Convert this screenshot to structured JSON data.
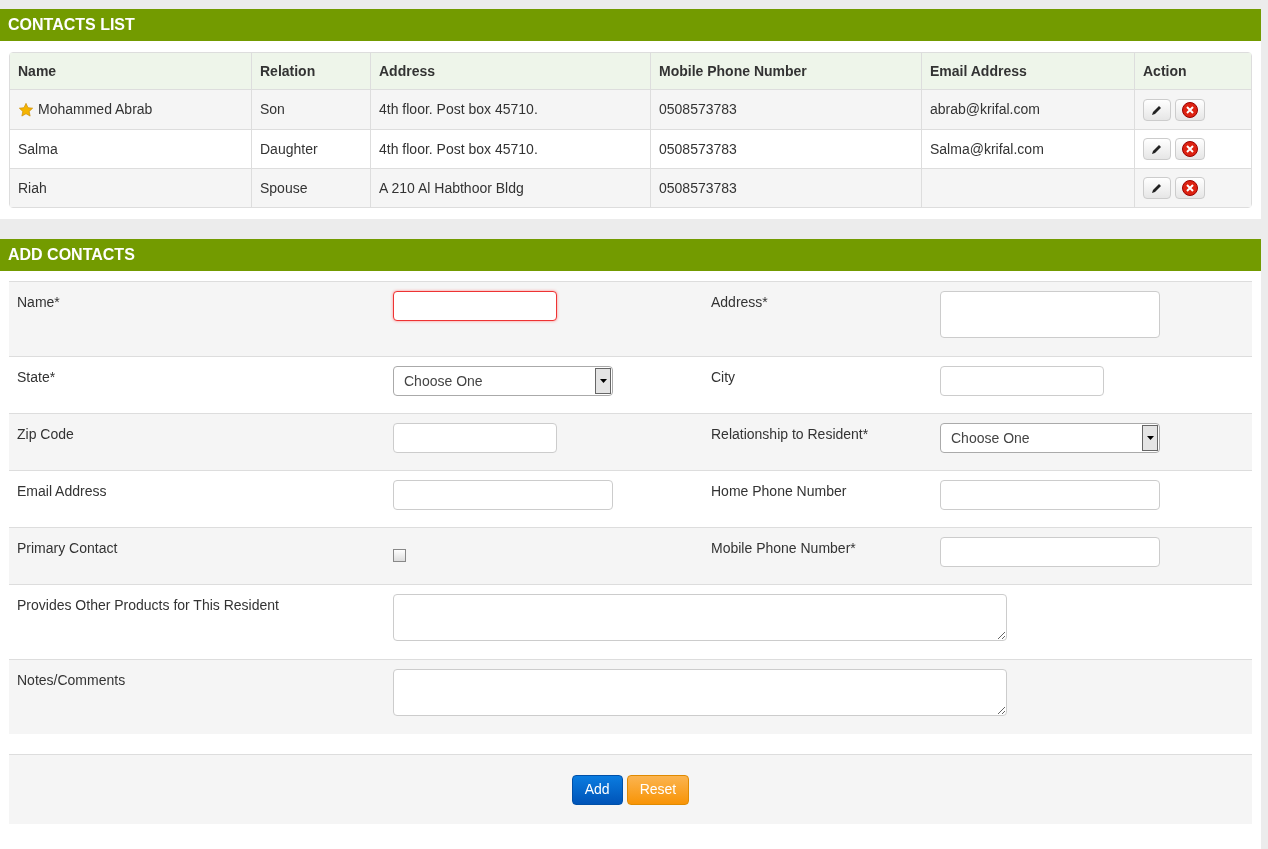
{
  "contacts_list": {
    "title": "CONTACTS LIST",
    "columns": [
      "Name",
      "Relation",
      "Address",
      "Mobile Phone Number",
      "Email Address",
      "Action"
    ],
    "rows": [
      {
        "primary": true,
        "cells": [
          "Mohammed Abrab",
          "Son",
          "4th floor. Post box 45710.",
          "0508573783",
          "abrab@krifal.com"
        ]
      },
      {
        "primary": false,
        "cells": [
          "Salma",
          "Daughter",
          "4th floor. Post box 45710.",
          "0508573783",
          "Salma@krifal.com"
        ]
      },
      {
        "primary": false,
        "cells": [
          "Riah",
          "Spouse",
          "A 210 Al Habthoor Bldg",
          "0508573783",
          ""
        ]
      }
    ]
  },
  "add_contacts": {
    "title": "ADD CONTACTS",
    "rows": [
      {
        "fields": [
          {
            "label": "Name*",
            "kind": "short",
            "invalid": true
          },
          {
            "label": "Address*",
            "kind": "area",
            "invalid": false
          }
        ]
      },
      {
        "fields": [
          {
            "label": "State*",
            "kind": "select",
            "value": "Choose One"
          },
          {
            "label": "City",
            "kind": "short",
            "invalid": false
          }
        ]
      },
      {
        "fields": [
          {
            "label": "Zip Code",
            "kind": "short",
            "invalid": false
          },
          {
            "label": "Relationship to Resident*",
            "kind": "select",
            "value": "Choose One"
          }
        ]
      },
      {
        "fields": [
          {
            "label": "Email Address",
            "kind": "text",
            "invalid": false
          },
          {
            "label": "Home Phone Number",
            "kind": "text",
            "invalid": false
          }
        ]
      },
      {
        "fields": [
          {
            "label": "Primary Contact",
            "kind": "checkbox",
            "checked": false
          },
          {
            "label": "Mobile Phone Number*",
            "kind": "text",
            "invalid": false
          }
        ]
      },
      {
        "fields": [
          {
            "label": "Provides Other Products for This Resident",
            "kind": "wide"
          }
        ]
      },
      {
        "fields": [
          {
            "label": "Notes/Comments",
            "kind": "wide"
          }
        ]
      }
    ],
    "buttons": [
      {
        "label": "Add",
        "kind": "primary"
      },
      {
        "label": "Reset",
        "kind": "warning"
      }
    ]
  }
}
